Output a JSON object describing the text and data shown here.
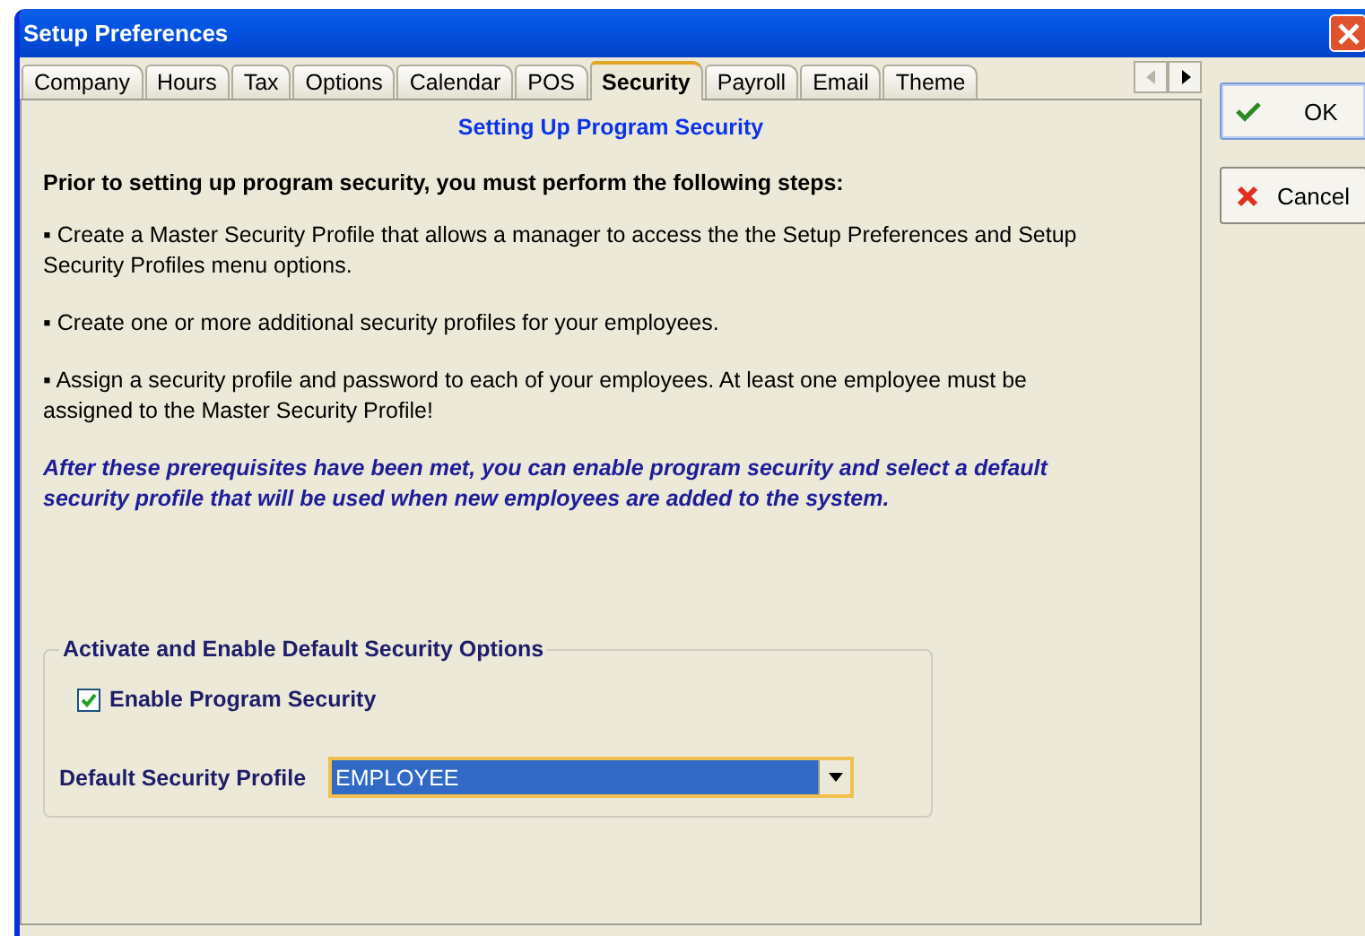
{
  "window": {
    "title": "Setup Preferences"
  },
  "tabs": [
    {
      "label": "Company",
      "selected": false
    },
    {
      "label": "Hours",
      "selected": false
    },
    {
      "label": "Tax",
      "selected": false
    },
    {
      "label": "Options",
      "selected": false
    },
    {
      "label": "Calendar",
      "selected": false
    },
    {
      "label": "POS",
      "selected": false
    },
    {
      "label": "Security",
      "selected": true
    },
    {
      "label": "Payroll",
      "selected": false
    },
    {
      "label": "Email",
      "selected": false
    },
    {
      "label": "Theme",
      "selected": false
    }
  ],
  "tab_scroll": {
    "left_disabled": true,
    "right_disabled": false
  },
  "content": {
    "heading": "Setting Up Program Security",
    "intro": "Prior to setting up program security, you must perform the following steps:",
    "steps": [
      "▪ Create a Master Security Profile that allows a manager to access the the Setup Preferences and Setup Security Profiles menu options.",
      "▪ Create one or more additional security profiles for your employees.",
      "▪ Assign a security profile and password to each of your employees.  At least one employee must be assigned to the Master Security Profile!"
    ],
    "note": "After these prerequisites have been met, you can enable program security and select a default security profile that will be used when new employees are added to the system."
  },
  "group": {
    "title": "Activate and Enable Default Security Options",
    "checkbox": {
      "label": "Enable Program Security",
      "checked": true
    },
    "dropdown": {
      "label": "Default Security Profile",
      "value": "EMPLOYEE"
    }
  },
  "buttons": [
    {
      "label": "OK",
      "kind": "ok"
    },
    {
      "label": "Cancel",
      "kind": "cancel"
    }
  ]
}
